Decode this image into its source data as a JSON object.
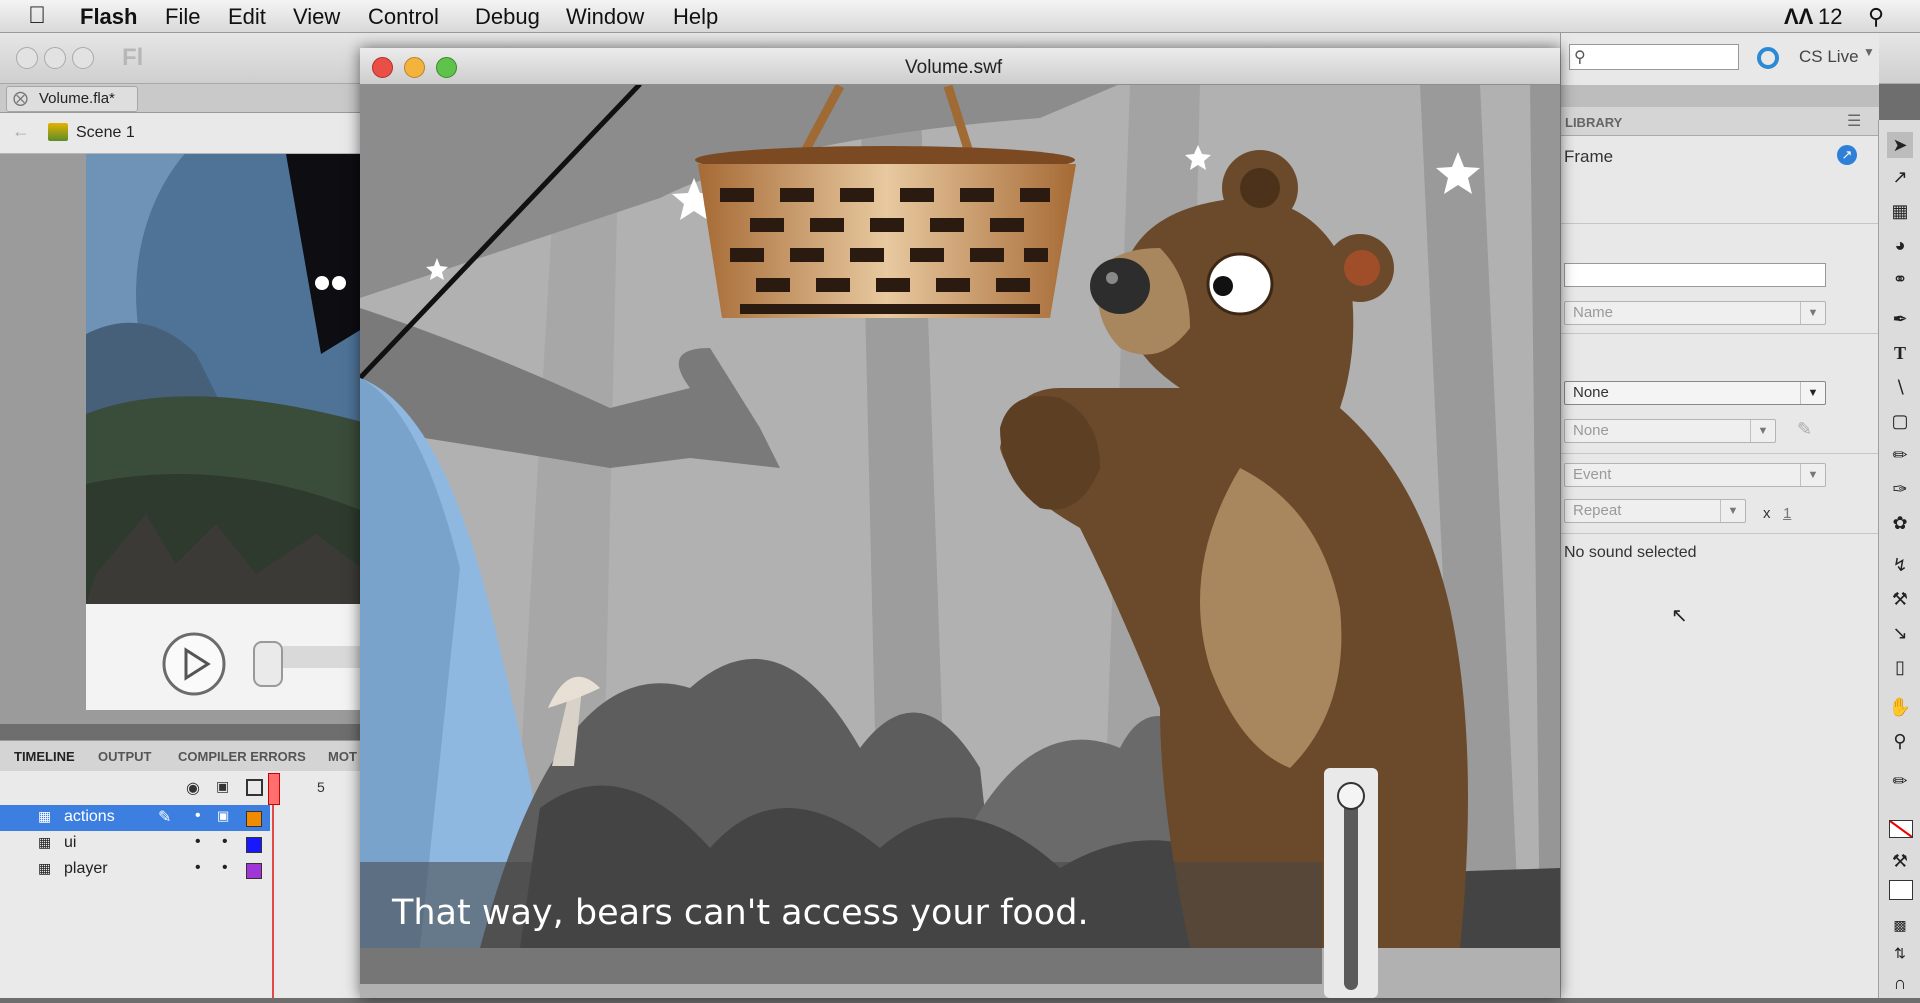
{
  "menubar": {
    "app_name": "Flash",
    "items": [
      "File",
      "Edit",
      "View",
      "Control",
      "Debug",
      "Window",
      "Help"
    ],
    "adobe_count": "12"
  },
  "document": {
    "tab_label": "Volume.fla*",
    "scene_label": "Scene 1",
    "fl_badge": "Fl"
  },
  "timeline": {
    "tabs": [
      "TIMELINE",
      "OUTPUT",
      "COMPILER ERRORS",
      "MOT"
    ],
    "frame_mark": "5",
    "layers": [
      {
        "name": "actions",
        "color": "#f08a00",
        "selected": true
      },
      {
        "name": "ui",
        "color": "#1818ff",
        "selected": false
      },
      {
        "name": "player",
        "color": "#a035d8",
        "selected": false
      }
    ]
  },
  "swf_window": {
    "title": "Volume.swf",
    "subtitle": "That way, bears can't access your food."
  },
  "right_panel": {
    "search_placeholder": "",
    "cs_live": "CS Live",
    "library_tab": "LIBRARY",
    "frame_label": "Frame",
    "name_placeholder": "Name",
    "sound_select": "None",
    "effect_select": "None",
    "sync_select": "Event",
    "repeat_select": "Repeat",
    "repeat_x": "x",
    "repeat_count": "1",
    "status": "No sound selected"
  },
  "colors": {
    "selected_layer": "#3d7fe0",
    "sky_blue": "#8fb8e0",
    "bear_brown": "#6b4a2b"
  }
}
